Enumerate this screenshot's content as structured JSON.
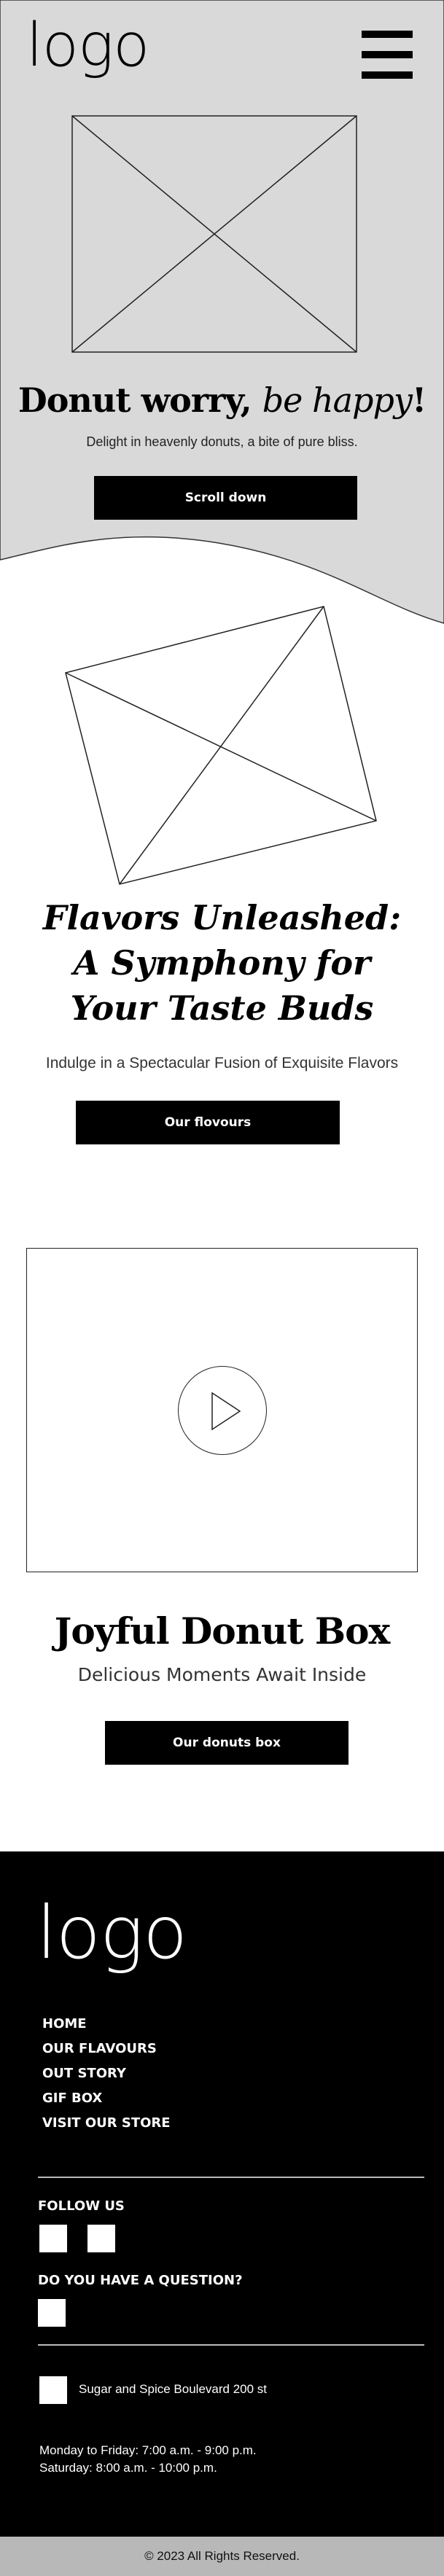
{
  "header": {
    "logo": "logo",
    "menu_icon": "hamburger-menu-icon"
  },
  "hero": {
    "title_main": "Donut worry, ",
    "title_em": "be happy",
    "title_end": "!",
    "subtitle": "Delight in heavenly donuts, a bite of pure bliss.",
    "button": "Scroll down",
    "image_icon": "image-placeholder-icon"
  },
  "flavors": {
    "title": "Flavors Unleashed: A Symphony for Your Taste Buds",
    "subtitle": "Indulge in a Spectacular Fusion of Exquisite Flavors",
    "button": "Our flovours",
    "image_icon": "image-placeholder-icon"
  },
  "donut_box": {
    "video_icon": "play-icon",
    "title": "Joyful Donut Box",
    "subtitle": "Delicious Moments Await Inside",
    "button": "Our donuts box"
  },
  "footer": {
    "logo": "logo",
    "nav": [
      "HOME",
      "OUR FLAVOURS",
      "OUT STORY",
      "GIF BOX",
      "VISIT OUR STORE"
    ],
    "follow_label": "FOLLOW US",
    "question_label": "DO YOU HAVE A QUESTION?",
    "address": "Sugar and Spice Boulevard 200 st",
    "hours_weekday": "Monday to Friday: 7:00 a.m. - 9:00 p.m.",
    "hours_weekend": "Saturday: 8:00 a.m. - 10:00 p.m.",
    "copyright": "© 2023  All Rights Reserved."
  },
  "colors": {
    "hero_bg": "#d9d9d9",
    "footer_bg": "#000000",
    "copyright_bg": "#b8b8b8",
    "button_bg": "#000000"
  }
}
